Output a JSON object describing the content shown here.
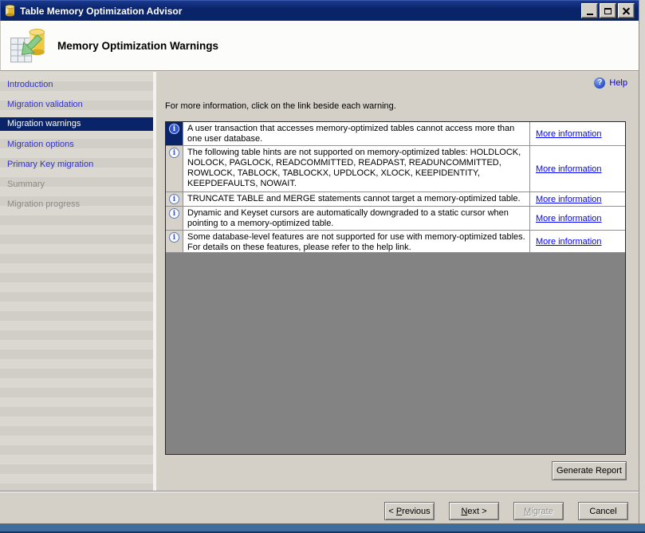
{
  "window": {
    "title": "Table Memory Optimization Advisor",
    "icons": {
      "titlebar": "database-icon",
      "minimize": "minimize-icon",
      "maximize": "maximize-icon",
      "close": "close-icon"
    }
  },
  "header": {
    "title": "Memory Optimization Warnings",
    "icon": "table-memory-optimization-icon"
  },
  "sidebar": {
    "items": [
      {
        "label": "Introduction",
        "state": "link"
      },
      {
        "label": "Migration validation",
        "state": "link"
      },
      {
        "label": "Migration warnings",
        "state": "active"
      },
      {
        "label": "Migration options",
        "state": "link"
      },
      {
        "label": "Primary Key migration",
        "state": "link"
      },
      {
        "label": "Summary",
        "state": "disabled"
      },
      {
        "label": "Migration progress",
        "state": "disabled"
      }
    ]
  },
  "content": {
    "help": {
      "label": "Help",
      "icon_glyph": "?"
    },
    "instruction": "For more information, click on the link beside each warning.",
    "info_icon_glyph": "i",
    "warnings": [
      {
        "text": "A user transaction that accesses memory-optimized tables cannot access more than one user database.",
        "link": "More information"
      },
      {
        "text": "The following table hints are not supported on memory-optimized tables: HOLDLOCK, NOLOCK, PAGLOCK, READCOMMITTED, READPAST, READUNCOMMITTED, ROWLOCK, TABLOCK, TABLOCKX, UPDLOCK, XLOCK, KEEPIDENTITY, KEEPDEFAULTS, NOWAIT.",
        "link": "More information"
      },
      {
        "text": "TRUNCATE TABLE and MERGE statements cannot target a memory-optimized table.",
        "link": "More information"
      },
      {
        "text": "Dynamic and Keyset cursors are automatically downgraded to a static cursor when pointing to a memory-optimized table.",
        "link": "More information"
      },
      {
        "text": "Some database-level features are not supported for use with memory-optimized tables. For details on these features, please refer to the help link.",
        "link": "More information"
      }
    ],
    "generate_report_label": "Generate Report"
  },
  "footer": {
    "previous": {
      "pre": "< ",
      "key": "P",
      "post": "revious"
    },
    "next": {
      "pre": "",
      "key": "N",
      "post": "ext >"
    },
    "migrate": {
      "pre": "",
      "key": "M",
      "post": "igrate"
    },
    "cancel_label": "Cancel"
  },
  "colors": {
    "titlebar": "#0A246A",
    "dialog_background": "#D4D0C8",
    "selected_nav_background": "#0A246A",
    "link_blue": "#0000FF",
    "grid_filler_gray": "#838383"
  }
}
